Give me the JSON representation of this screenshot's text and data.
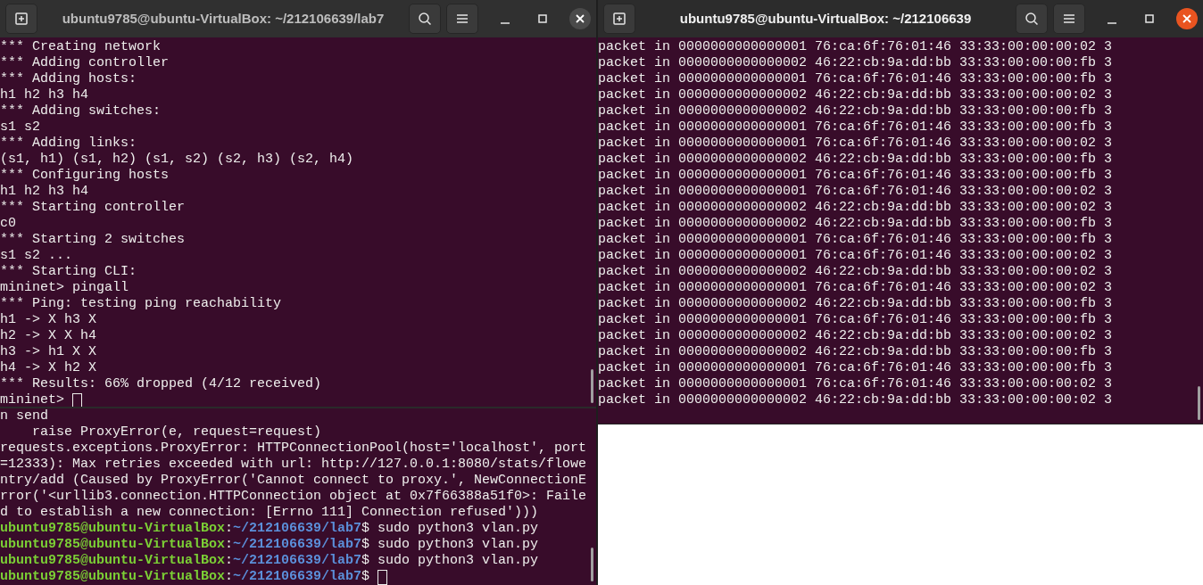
{
  "windows": [
    {
      "title": "ubuntu9785@ubuntu-VirtualBox: ~/212106639/lab7",
      "active": false,
      "panes": [
        {
          "lines": [
            {
              "kind": "output",
              "text": "*** Creating network"
            },
            {
              "kind": "output",
              "text": "*** Adding controller"
            },
            {
              "kind": "output",
              "text": "*** Adding hosts:"
            },
            {
              "kind": "output",
              "text": "h1 h2 h3 h4"
            },
            {
              "kind": "output",
              "text": "*** Adding switches:"
            },
            {
              "kind": "output",
              "text": "s1 s2"
            },
            {
              "kind": "output",
              "text": "*** Adding links:"
            },
            {
              "kind": "output",
              "text": "(s1, h1) (s1, h2) (s1, s2) (s2, h3) (s2, h4)"
            },
            {
              "kind": "output",
              "text": "*** Configuring hosts"
            },
            {
              "kind": "output",
              "text": "h1 h2 h3 h4"
            },
            {
              "kind": "output",
              "text": "*** Starting controller"
            },
            {
              "kind": "output",
              "text": "c0"
            },
            {
              "kind": "output",
              "text": "*** Starting 2 switches"
            },
            {
              "kind": "output",
              "text": "s1 s2 ..."
            },
            {
              "kind": "output",
              "text": "*** Starting CLI:"
            },
            {
              "kind": "output",
              "text": "mininet> pingall"
            },
            {
              "kind": "output",
              "text": "*** Ping: testing ping reachability"
            },
            {
              "kind": "output",
              "text": "h1 -> X h3 X"
            },
            {
              "kind": "output",
              "text": "h2 -> X X h4"
            },
            {
              "kind": "output",
              "text": "h3 -> h1 X X"
            },
            {
              "kind": "output",
              "text": "h4 -> X h2 X"
            },
            {
              "kind": "output",
              "text": "*** Results: 66% dropped (4/12 received)"
            },
            {
              "kind": "output",
              "text": "mininet> ",
              "cursor": true
            }
          ]
        },
        {
          "lines": [
            {
              "kind": "output",
              "text": "n send"
            },
            {
              "kind": "output",
              "text": "    raise ProxyError(e, request=request)"
            },
            {
              "kind": "output",
              "text": "requests.exceptions.ProxyError: HTTPConnectionPool(host='localhost', port"
            },
            {
              "kind": "output",
              "text": "=12333): Max retries exceeded with url: http://127.0.0.1:8080/stats/flowe"
            },
            {
              "kind": "output",
              "text": "ntry/add (Caused by ProxyError('Cannot connect to proxy.', NewConnectionE"
            },
            {
              "kind": "output",
              "text": "rror('<urllib3.connection.HTTPConnection object at 0x7f66388a51f0>: Faile"
            },
            {
              "kind": "output",
              "text": "d to establish a new connection: [Errno 111] Connection refused')))"
            },
            {
              "kind": "prompt",
              "user_host": "ubuntu9785@ubuntu-VirtualBox",
              "separator": ":",
              "path": "~/212106639/lab7",
              "command": "$ sudo python3 vlan.py"
            },
            {
              "kind": "prompt",
              "user_host": "ubuntu9785@ubuntu-VirtualBox",
              "separator": ":",
              "path": "~/212106639/lab7",
              "command": "$ sudo python3 vlan.py"
            },
            {
              "kind": "prompt",
              "user_host": "ubuntu9785@ubuntu-VirtualBox",
              "separator": ":",
              "path": "~/212106639/lab7",
              "command": "$ sudo python3 vlan.py"
            },
            {
              "kind": "prompt",
              "user_host": "ubuntu9785@ubuntu-VirtualBox",
              "separator": ":",
              "path": "~/212106639/lab7",
              "command": "$ ",
              "cursor": true
            }
          ]
        }
      ]
    },
    {
      "title": "ubuntu9785@ubuntu-VirtualBox: ~/212106639",
      "active": true,
      "panes": [
        {
          "lines": [
            {
              "kind": "output",
              "text": "packet in 0000000000000001 76:ca:6f:76:01:46 33:33:00:00:00:02 3"
            },
            {
              "kind": "output",
              "text": "packet in 0000000000000002 46:22:cb:9a:dd:bb 33:33:00:00:00:fb 3"
            },
            {
              "kind": "output",
              "text": "packet in 0000000000000001 76:ca:6f:76:01:46 33:33:00:00:00:fb 3"
            },
            {
              "kind": "output",
              "text": "packet in 0000000000000002 46:22:cb:9a:dd:bb 33:33:00:00:00:02 3"
            },
            {
              "kind": "output",
              "text": "packet in 0000000000000002 46:22:cb:9a:dd:bb 33:33:00:00:00:fb 3"
            },
            {
              "kind": "output",
              "text": "packet in 0000000000000001 76:ca:6f:76:01:46 33:33:00:00:00:fb 3"
            },
            {
              "kind": "output",
              "text": "packet in 0000000000000001 76:ca:6f:76:01:46 33:33:00:00:00:02 3"
            },
            {
              "kind": "output",
              "text": "packet in 0000000000000002 46:22:cb:9a:dd:bb 33:33:00:00:00:fb 3"
            },
            {
              "kind": "output",
              "text": "packet in 0000000000000001 76:ca:6f:76:01:46 33:33:00:00:00:fb 3"
            },
            {
              "kind": "output",
              "text": "packet in 0000000000000001 76:ca:6f:76:01:46 33:33:00:00:00:02 3"
            },
            {
              "kind": "output",
              "text": "packet in 0000000000000002 46:22:cb:9a:dd:bb 33:33:00:00:00:02 3"
            },
            {
              "kind": "output",
              "text": "packet in 0000000000000002 46:22:cb:9a:dd:bb 33:33:00:00:00:fb 3"
            },
            {
              "kind": "output",
              "text": "packet in 0000000000000001 76:ca:6f:76:01:46 33:33:00:00:00:fb 3"
            },
            {
              "kind": "output",
              "text": "packet in 0000000000000001 76:ca:6f:76:01:46 33:33:00:00:00:02 3"
            },
            {
              "kind": "output",
              "text": "packet in 0000000000000002 46:22:cb:9a:dd:bb 33:33:00:00:00:02 3"
            },
            {
              "kind": "output",
              "text": "packet in 0000000000000001 76:ca:6f:76:01:46 33:33:00:00:00:02 3"
            },
            {
              "kind": "output",
              "text": "packet in 0000000000000002 46:22:cb:9a:dd:bb 33:33:00:00:00:fb 3"
            },
            {
              "kind": "output",
              "text": "packet in 0000000000000001 76:ca:6f:76:01:46 33:33:00:00:00:fb 3"
            },
            {
              "kind": "output",
              "text": "packet in 0000000000000002 46:22:cb:9a:dd:bb 33:33:00:00:00:02 3"
            },
            {
              "kind": "output",
              "text": "packet in 0000000000000002 46:22:cb:9a:dd:bb 33:33:00:00:00:fb 3"
            },
            {
              "kind": "output",
              "text": "packet in 0000000000000001 76:ca:6f:76:01:46 33:33:00:00:00:fb 3"
            },
            {
              "kind": "output",
              "text": "packet in 0000000000000001 76:ca:6f:76:01:46 33:33:00:00:00:02 3"
            },
            {
              "kind": "output",
              "text": "packet in 0000000000000002 46:22:cb:9a:dd:bb 33:33:00:00:00:02 3"
            }
          ]
        }
      ]
    }
  ]
}
